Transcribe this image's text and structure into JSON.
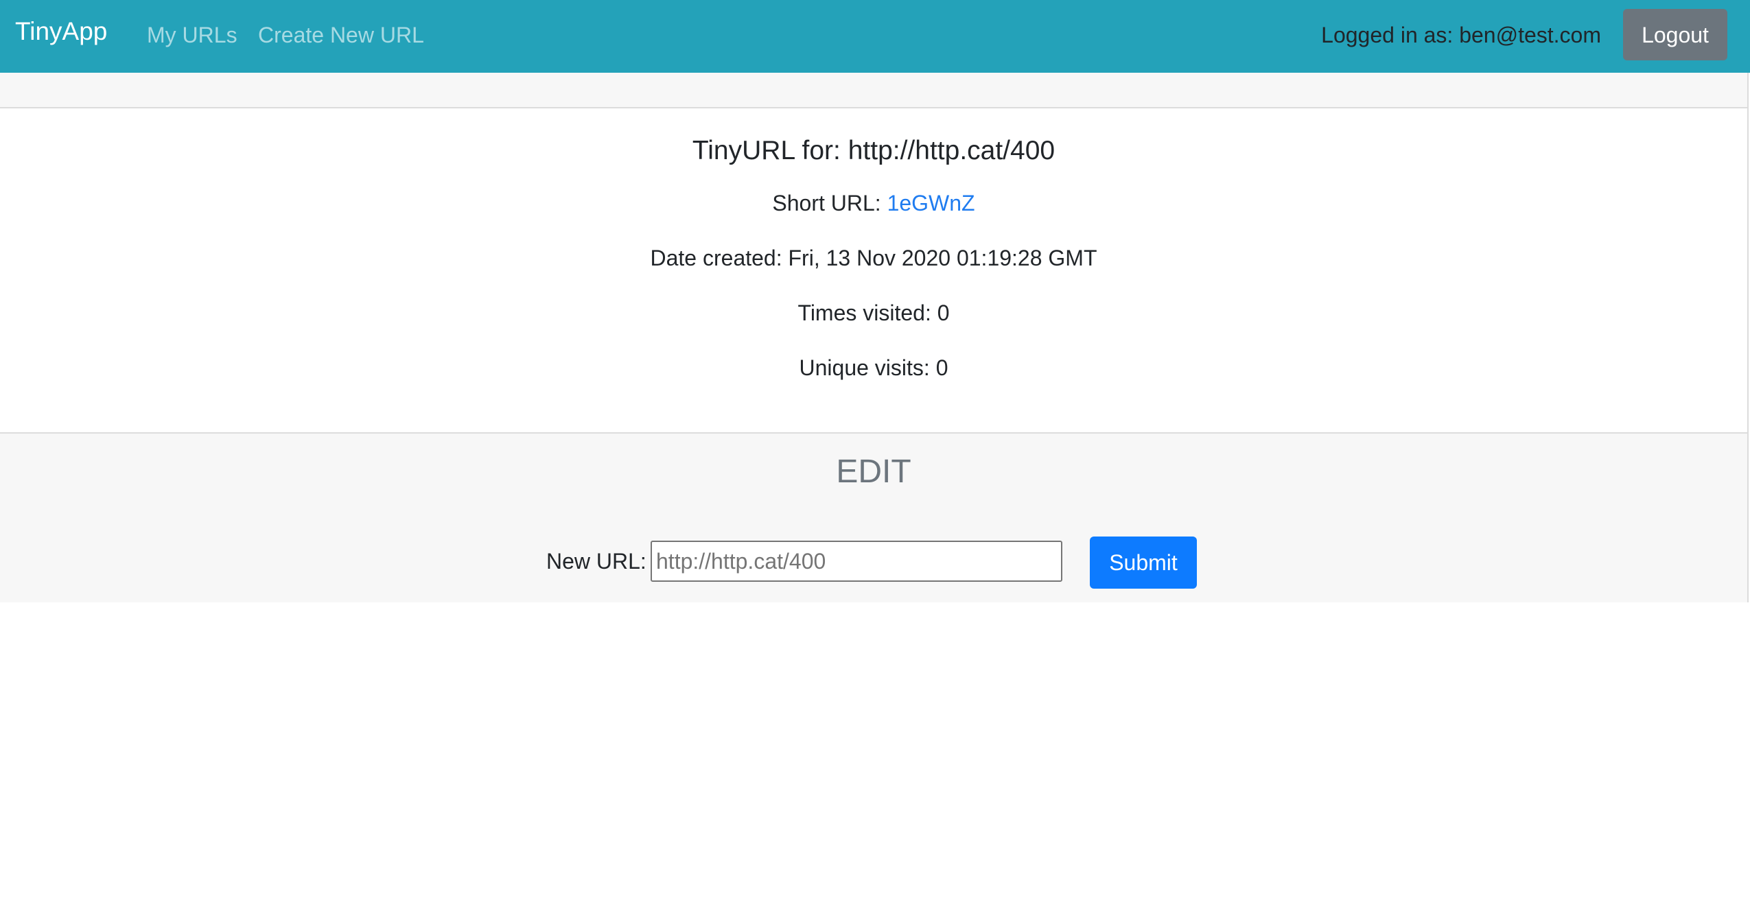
{
  "navbar": {
    "brand": "TinyApp",
    "links": [
      {
        "label": "My URLs"
      },
      {
        "label": "Create New URL"
      }
    ],
    "logged_in_text": "Logged in as: ben@test.com",
    "logout_label": "Logout",
    "colors": {
      "background": "#24a2b9",
      "logout_button": "#6c757d"
    }
  },
  "url_card": {
    "title": "TinyURL for: http://http.cat/400",
    "short_url_label": "Short URL: ",
    "short_url": "1eGWnZ",
    "date_created": "Date created: Fri, 13 Nov 2020 01:19:28 GMT",
    "times_visited": "Times visited: 0",
    "unique_visits": "Unique visits: 0"
  },
  "edit": {
    "title": "EDIT",
    "new_url_label": "New URL:",
    "input_placeholder": "http://http.cat/400",
    "submit_label": "Submit",
    "colors": {
      "submit_button": "#0d7bff",
      "link": "#1f7cf0"
    }
  }
}
